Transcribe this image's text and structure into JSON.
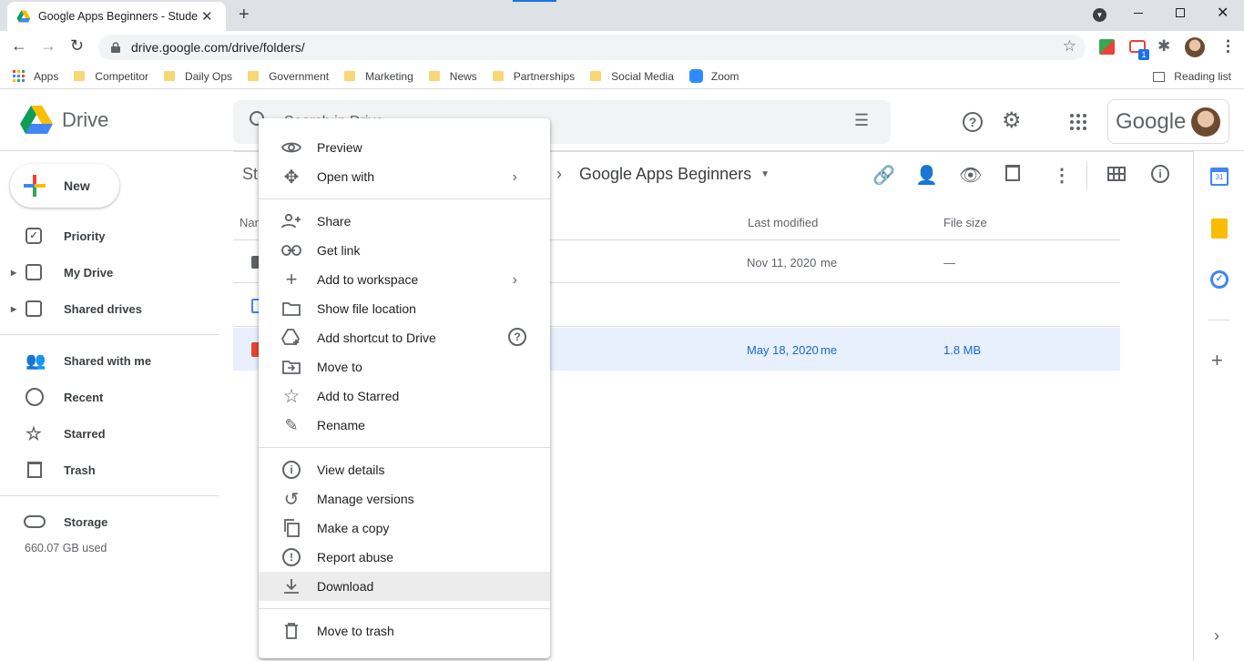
{
  "browser": {
    "tab_title": "Google Apps Beginners - Student",
    "url": "drive.google.com/drive/folders/",
    "bookmarks": [
      {
        "label": "Apps",
        "icon": "apps-grid-icon"
      },
      {
        "label": "Competitor",
        "icon": "folder-icon"
      },
      {
        "label": "Daily Ops",
        "icon": "folder-icon"
      },
      {
        "label": "Government",
        "icon": "folder-icon"
      },
      {
        "label": "Marketing",
        "icon": "folder-icon"
      },
      {
        "label": "News",
        "icon": "folder-icon"
      },
      {
        "label": "Partnerships",
        "icon": "folder-icon"
      },
      {
        "label": "Social Media",
        "icon": "folder-icon"
      },
      {
        "label": "Zoom",
        "icon": "zoom-icon"
      }
    ],
    "reading_list": "Reading list",
    "extension_badge": "1"
  },
  "drive": {
    "app_name": "Drive",
    "search_placeholder": "Search in Drive",
    "google_label": "Google",
    "new_button": "New",
    "sidebar": [
      {
        "label": "Priority",
        "icon": "priority-icon"
      },
      {
        "label": "My Drive",
        "icon": "my-drive-icon"
      },
      {
        "label": "Shared drives",
        "icon": "shared-drives-icon"
      },
      {
        "label": "Shared with me",
        "icon": "people-icon"
      },
      {
        "label": "Recent",
        "icon": "clock-icon"
      },
      {
        "label": "Starred",
        "icon": "star-icon"
      },
      {
        "label": "Trash",
        "icon": "trash-icon"
      }
    ],
    "storage_label": "Storage",
    "storage_used": "660.07 GB used",
    "breadcrumb_start": "Stu",
    "breadcrumb_current": "Google Apps Beginners",
    "columns": {
      "name": "Name",
      "last_modified": "Last modified",
      "file_size": "File size"
    },
    "rows": [
      {
        "modified": "Nov 11, 2020",
        "owner": "me",
        "size": "—",
        "selected": false
      },
      {
        "modified": "",
        "owner": "",
        "size": "",
        "selected": false
      },
      {
        "modified": "May 18, 2020",
        "owner": "me",
        "size": "1.8 MB",
        "selected": true
      }
    ]
  },
  "context_menu": {
    "groups": [
      [
        {
          "label": "Preview",
          "icon": "eye-icon"
        },
        {
          "label": "Open with",
          "icon": "move-arrows-icon",
          "submenu": true
        }
      ],
      [
        {
          "label": "Share",
          "icon": "add-person-icon"
        },
        {
          "label": "Get link",
          "icon": "link-icon"
        },
        {
          "label": "Add to workspace",
          "icon": "plus-icon",
          "submenu": true
        },
        {
          "label": "Show file location",
          "icon": "folder-outline-icon"
        },
        {
          "label": "Add shortcut to Drive",
          "icon": "drive-shortcut-icon",
          "help": true
        },
        {
          "label": "Move to",
          "icon": "move-to-folder-icon"
        },
        {
          "label": "Add to Starred",
          "icon": "star-outline-icon"
        },
        {
          "label": "Rename",
          "icon": "pencil-icon"
        }
      ],
      [
        {
          "label": "View details",
          "icon": "info-icon"
        },
        {
          "label": "Manage versions",
          "icon": "history-icon"
        },
        {
          "label": "Make a copy",
          "icon": "copy-icon"
        },
        {
          "label": "Report abuse",
          "icon": "alert-icon"
        },
        {
          "label": "Download",
          "icon": "download-icon",
          "highlighted": true
        }
      ],
      [
        {
          "label": "Move to trash",
          "icon": "trash-icon"
        }
      ]
    ]
  }
}
